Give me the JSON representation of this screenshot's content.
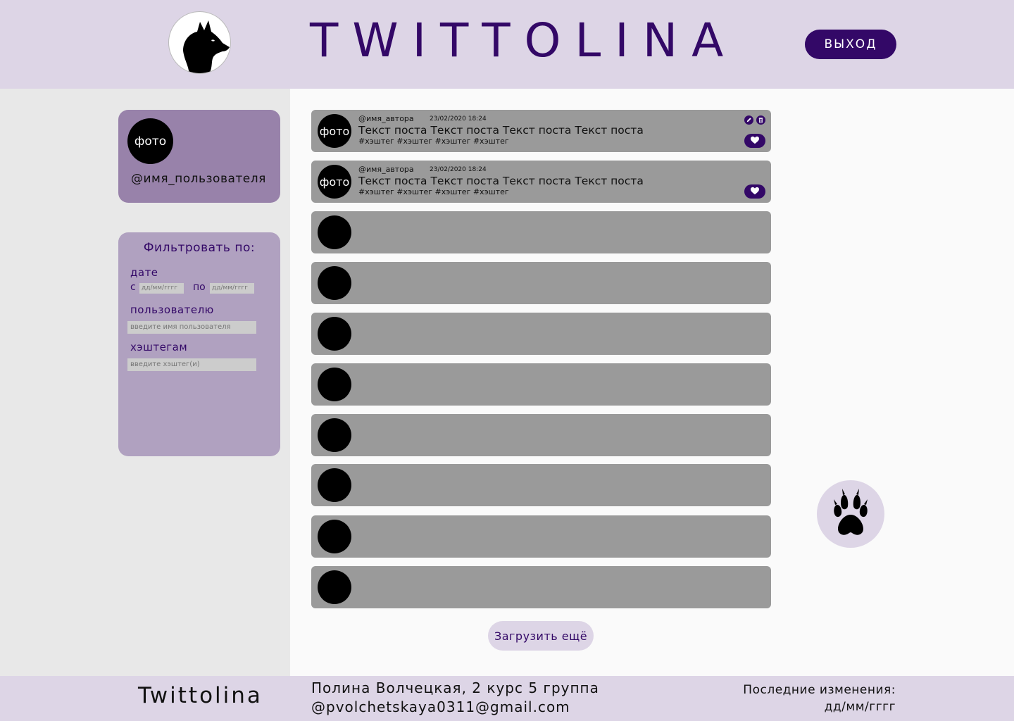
{
  "header": {
    "title": "TWITTOLINA",
    "logout_label": "ВЫХОД",
    "logo_icon": "wolf-head-icon"
  },
  "profile": {
    "photo_label": "фото",
    "username": "@имя_пользователя"
  },
  "filter": {
    "title": "Фильтровать по:",
    "date_label": "дате",
    "from_label": "с",
    "to_label": "по",
    "from_placeholder": "дд/мм/гггг",
    "to_placeholder": "дд/мм/гггг",
    "user_label": "пользователю",
    "user_placeholder": "введите имя пользователя",
    "hashtag_label": "хэштегам",
    "hashtag_placeholder": "введите хэштег(и)"
  },
  "posts": [
    {
      "avatar_label": "фото",
      "author": "@имя_автора",
      "date": "23/02/2020 18:24",
      "text": "Текст поста Текст поста Текст поста Текст поста",
      "tags": "#хэштег #хэштег #хэштег #хэштег",
      "own": true
    },
    {
      "avatar_label": "фото",
      "author": "@имя_автора",
      "date": "23/02/2020 18:24",
      "text": "Текст поста Текст поста Текст поста Текст поста",
      "tags": "#хэштег #хэштег #хэштег #хэштег",
      "own": false
    }
  ],
  "empty_post_count": 8,
  "load_more_label": "Загрузить ещё",
  "paw_icon": "paw-icon",
  "footer": {
    "brand": "Twittolina",
    "author_line1": "Полина Волчецкая, 2 курс 5 группа",
    "author_line2": "@pvolchetskaya0311@gmail.com",
    "updated_label": "Последние изменения:",
    "updated_value": "дд/мм/гггг"
  },
  "colors": {
    "accent": "#330867",
    "header_bg": "#ddd5e6",
    "profile_bg": "#9882aa",
    "filter_bg": "#b0a1c0",
    "post_bg": "#9a9a9a"
  }
}
